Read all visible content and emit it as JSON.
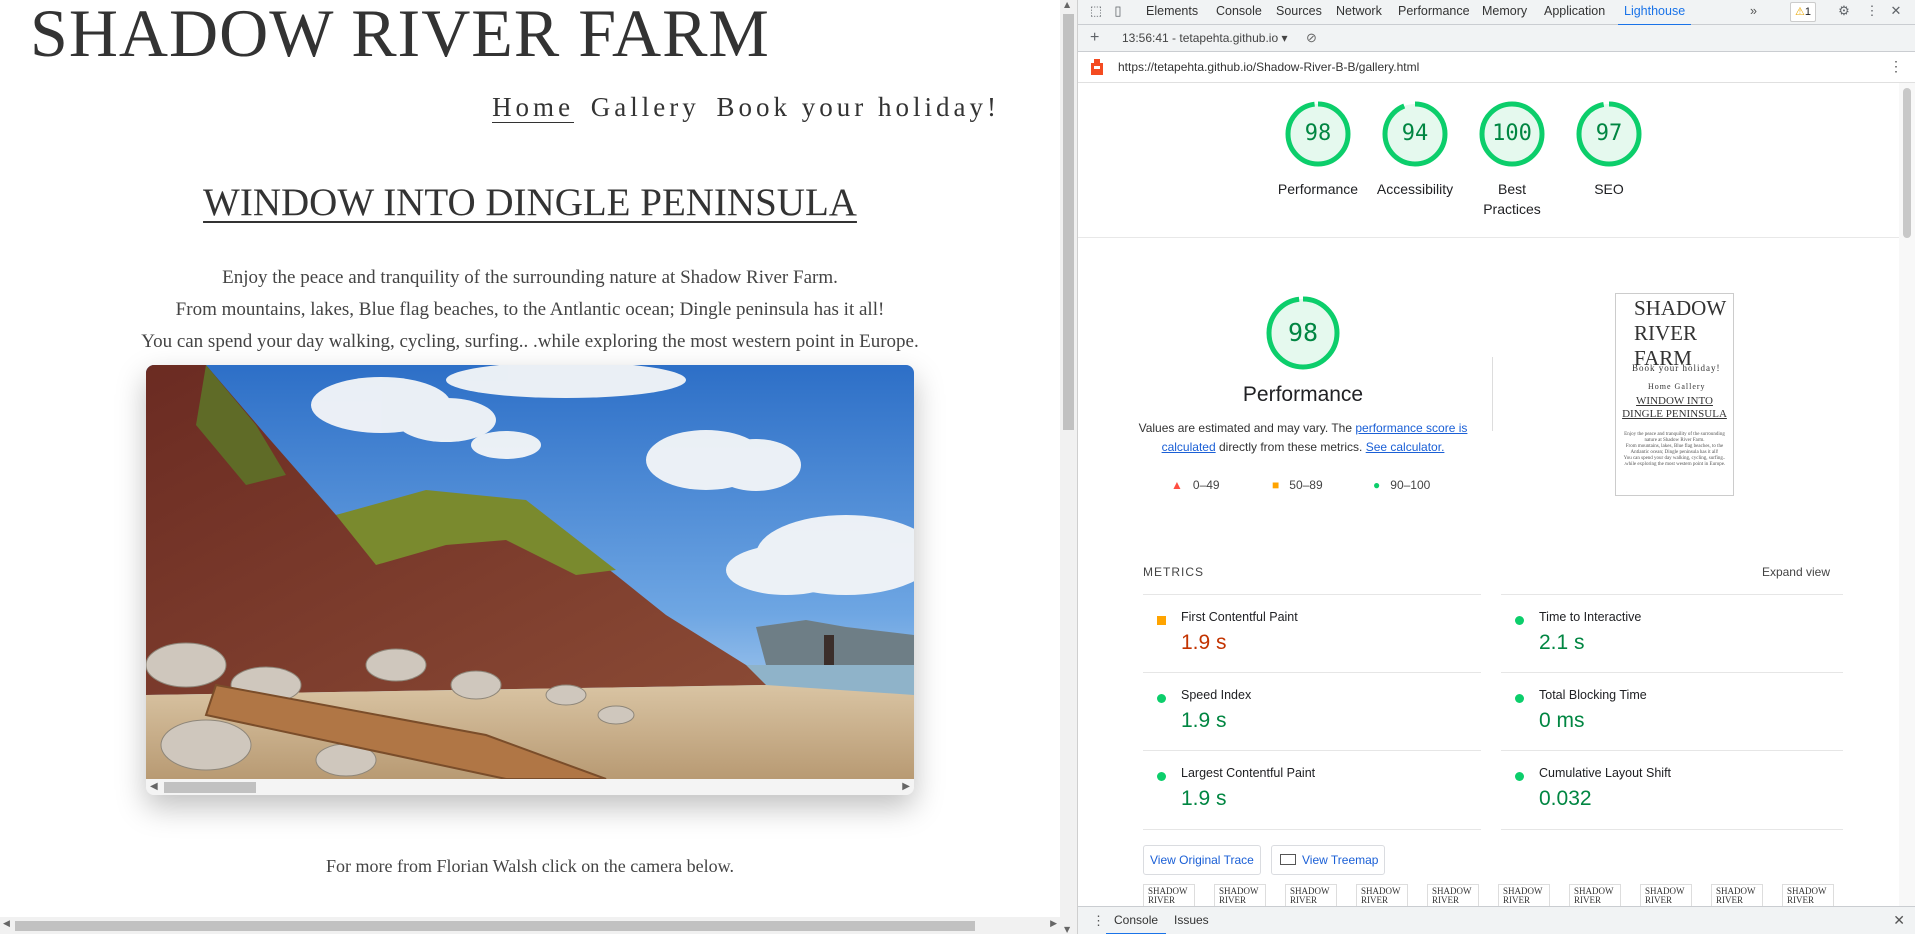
{
  "site": {
    "title": "SHADOW RIVER FARM",
    "nav": [
      "Home",
      "Gallery",
      "Book your holiday!"
    ],
    "heading": "WINDOW INTO DINGLE PENINSULA",
    "intro": [
      "Enjoy the peace and tranquility of the surrounding nature at Shadow River Farm.",
      "From mountains, lakes, Blue flag beaches, to the Antlantic ocean; Dingle peninsula has it all!",
      "You can spend your day walking, cycling, surfing.. .while exploring the most western point in Europe."
    ],
    "more_text": "For more from Florian Walsh click on the camera below."
  },
  "devtools": {
    "tabs": [
      "Elements",
      "Console",
      "Sources",
      "Network",
      "Performance",
      "Memory",
      "Application",
      "Lighthouse"
    ],
    "active_tab": "Lighthouse",
    "more_tabs": "»",
    "warning_count": "1",
    "report_label": "13:56:41 - tetapehta.github.io",
    "url": "https://tetapehta.github.io/Shadow-River-B-B/gallery.html",
    "scores": [
      {
        "value": "98",
        "label": "Performance"
      },
      {
        "value": "94",
        "label": "Accessibility"
      },
      {
        "value": "100",
        "label": "Best Practices"
      },
      {
        "value": "97",
        "label": "SEO"
      }
    ],
    "score_values": [
      98,
      94,
      100,
      97
    ],
    "performance": {
      "score": "98",
      "score_value": 98,
      "title": "Performance",
      "desc_pre": "Values are estimated and may vary. The ",
      "desc_link": "performance score is calculated",
      "desc_mid": " directly from these metrics. ",
      "desc_link2": "See calculator."
    },
    "legend": [
      "0–49",
      "50–89",
      "90–100"
    ],
    "screenshot": {
      "title": "SHADOW RIVER FARM",
      "nav1": "Book your holiday!",
      "nav2": "Home Gallery",
      "heading": "WINDOW INTO DINGLE PENINSULA",
      "para1": "Enjoy the peace and tranquility of the surrounding nature at Shadow River Farm.",
      "para2": "From mountains, lakes, Blue flag beaches, to the Antlantic ocean; Dingle peninsula has it all!",
      "para3": "You can spend your day walking, cycling, surfing.. .while exploring the most western point in Europe."
    },
    "metrics_header": "METRICS",
    "expand_label": "Expand view",
    "metrics": [
      {
        "name": "First Contentful Paint",
        "value": "1.9 s",
        "status": "orange"
      },
      {
        "name": "Time to Interactive",
        "value": "2.1 s",
        "status": "green"
      },
      {
        "name": "Speed Index",
        "value": "1.9 s",
        "status": "green"
      },
      {
        "name": "Total Blocking Time",
        "value": "0 ms",
        "status": "green"
      },
      {
        "name": "Largest Contentful Paint",
        "value": "1.9 s",
        "status": "green"
      },
      {
        "name": "Cumulative Layout Shift",
        "value": "0.032",
        "status": "green"
      }
    ],
    "buttons": {
      "trace": "View Original Trace",
      "treemap": "View Treemap"
    },
    "thumb_label": "SHADOW RIVER",
    "drawer_tabs": [
      "Console",
      "Issues"
    ],
    "colors": {
      "pass": "#0cce6b",
      "average": "#ffa400",
      "fail": "#ff4e42",
      "accent": "#1a73e8"
    }
  }
}
